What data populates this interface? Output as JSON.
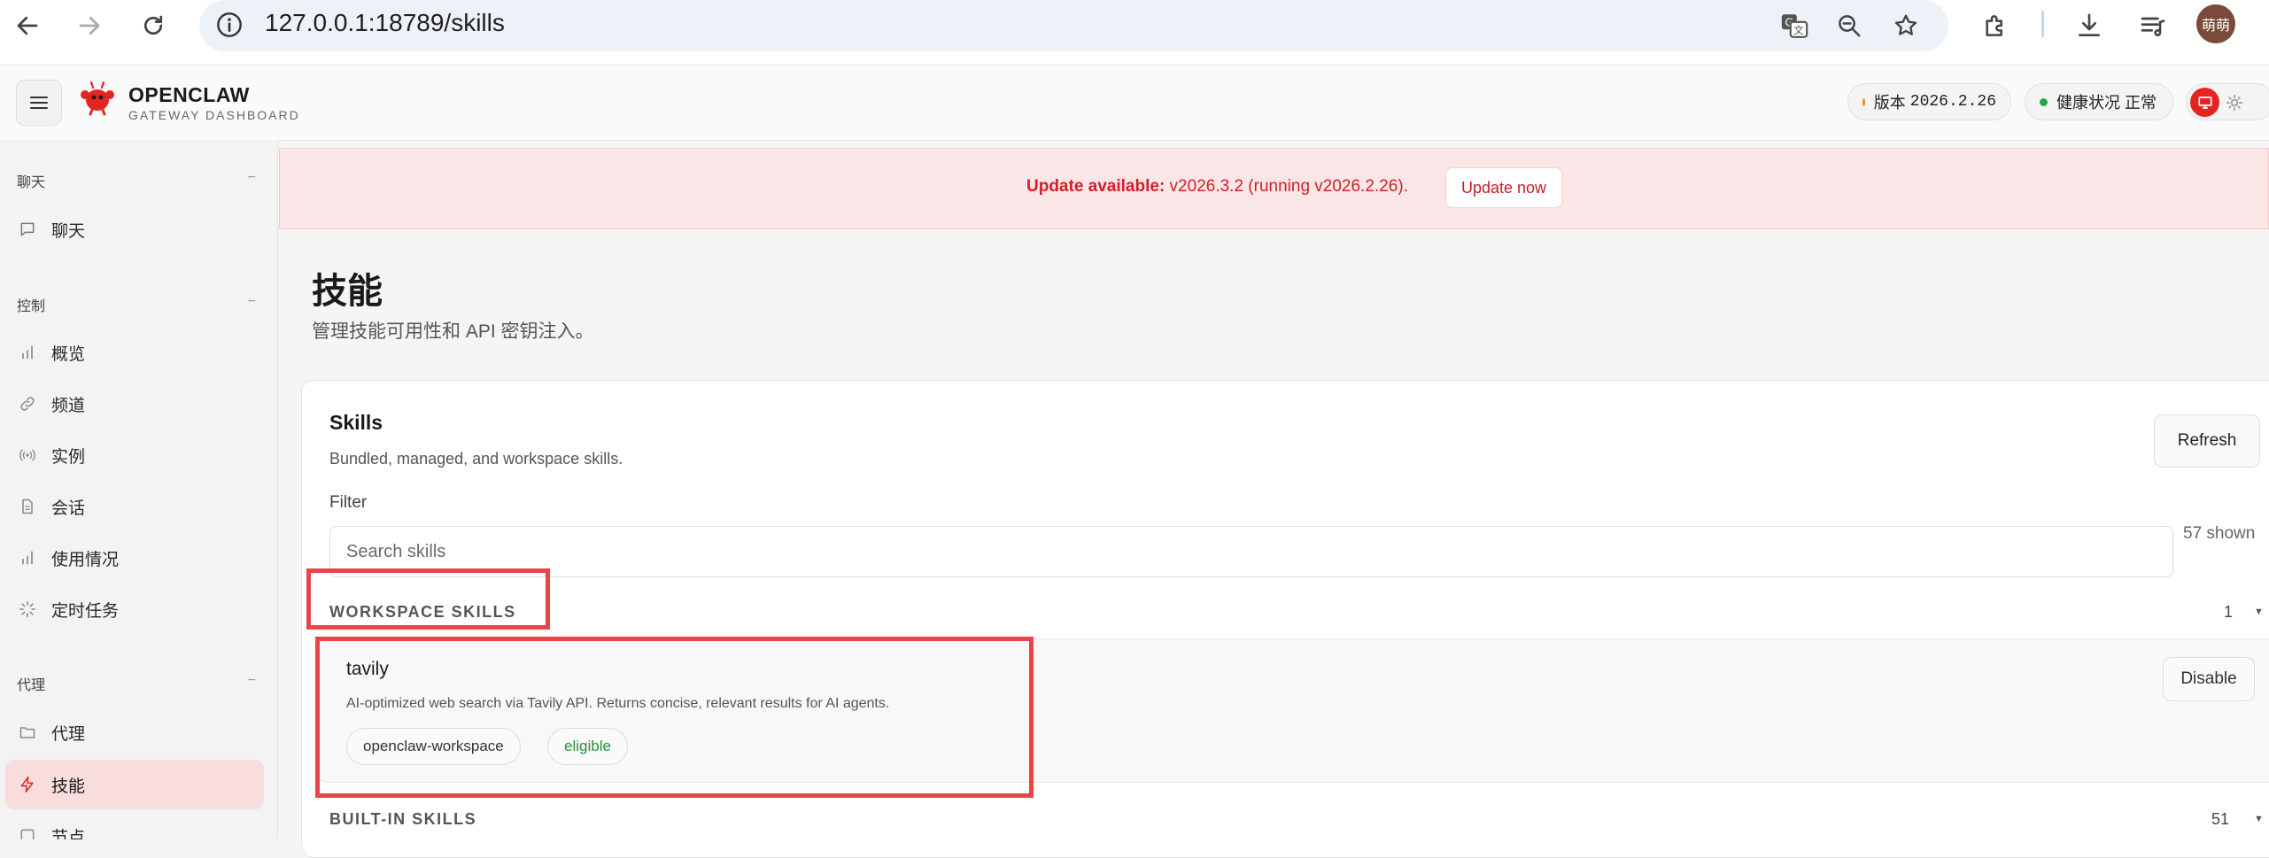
{
  "browser": {
    "url": "127.0.0.1:18789/skills",
    "avatar_text": "萌萌"
  },
  "header": {
    "brand_title": "OPENCLAW",
    "brand_subtitle": "GATEWAY DASHBOARD",
    "version_label": "版本",
    "version_value": "2026.2.26",
    "health_label": "健康状况",
    "health_value": "正常",
    "colors": {
      "accent": "#e52421",
      "version_dot": "#f08a1c",
      "health_dot": "#22a64a"
    }
  },
  "sidebar": {
    "sections": [
      {
        "title": "聊天",
        "collapse": "−",
        "items": [
          {
            "label": "聊天",
            "icon": "chat-bubble-icon"
          }
        ]
      },
      {
        "title": "控制",
        "collapse": "−",
        "items": [
          {
            "label": "概览",
            "icon": "bar-chart-icon"
          },
          {
            "label": "频道",
            "icon": "link-icon"
          },
          {
            "label": "实例",
            "icon": "broadcast-icon"
          },
          {
            "label": "会话",
            "icon": "document-icon"
          },
          {
            "label": "使用情况",
            "icon": "bar-chart-icon"
          },
          {
            "label": "定时任务",
            "icon": "loader-icon"
          }
        ]
      },
      {
        "title": "代理",
        "collapse": "−",
        "items": [
          {
            "label": "代理",
            "icon": "folder-icon"
          },
          {
            "label": "技能",
            "icon": "lightning-icon",
            "active": true
          },
          {
            "label": "节点",
            "icon": "square-icon"
          }
        ]
      }
    ]
  },
  "banner": {
    "prefix": "Update available:",
    "message": " v2026.3.2 (running v2026.2.26).",
    "button": "Update now"
  },
  "page": {
    "title": "技能",
    "subtitle": "管理技能可用性和 API 密钥注入。"
  },
  "skills_card": {
    "title": "Skills",
    "subtitle": "Bundled, managed, and workspace skills.",
    "refresh": "Refresh",
    "filter_label": "Filter",
    "search_placeholder": "Search skills",
    "shown": "57 shown",
    "groups": [
      {
        "title": "WORKSPACE SKILLS",
        "count": "1",
        "skills": [
          {
            "name": "tavily",
            "description": "AI-optimized web search via Tavily API. Returns concise, relevant results for AI agents.",
            "tags": [
              "openclaw-workspace",
              "eligible"
            ],
            "action": "Disable"
          }
        ]
      },
      {
        "title": "BUILT-IN SKILLS",
        "count": "51"
      }
    ]
  }
}
